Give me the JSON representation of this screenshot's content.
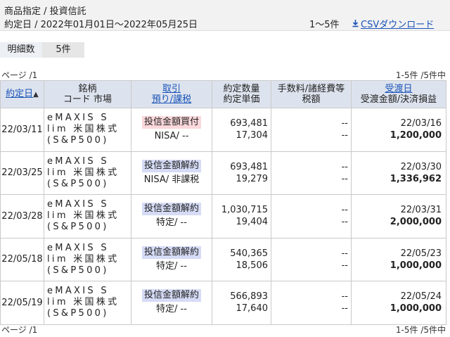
{
  "header": {
    "title": "商品指定 / 投資信託",
    "date_range": "約定日 / 2022年01月01日〜2022年05月25日",
    "count": "1〜5件",
    "csv_label": "CSVダウンロード"
  },
  "tabs": [
    {
      "label": "明細数"
    },
    {
      "label": "5件"
    }
  ],
  "pagination": {
    "page_label": "ページ /1",
    "range_label": "1-5件 /5件中"
  },
  "columns": {
    "date": "約定日",
    "sort_arrow": "▲",
    "fund_line1": "銘柄",
    "fund_line2": "コード 市場",
    "trade_line1": "取引",
    "trade_line2": "預り/課税",
    "qty_line1": "約定数量",
    "qty_line2": "約定単価",
    "fee_line1": "手数料/諸経費等",
    "fee_line2": "税額",
    "settle_line1": "受渡日",
    "settle_line2": "受渡金額/決済損益"
  },
  "rows": [
    {
      "date": "22/03/11",
      "name1": "eMAXIS S",
      "name2": "lim 米国株式",
      "name3": "(S&P500)",
      "trade": "投信金額買付",
      "trade_kind": "buy",
      "account": "NISA/ --",
      "qty": "693,481",
      "price": "17,304",
      "fee": "--",
      "tax": "--",
      "settle_date": "22/03/16",
      "amount": "1,200,000"
    },
    {
      "date": "22/03/25",
      "name1": "eMAXIS S",
      "name2": "lim 米国株式",
      "name3": "(S&P500)",
      "trade": "投信金額解約",
      "trade_kind": "sell",
      "account": "NISA/ 非課税",
      "qty": "693,481",
      "price": "19,279",
      "fee": "--",
      "tax": "--",
      "settle_date": "22/03/30",
      "amount": "1,336,962"
    },
    {
      "date": "22/03/28",
      "name1": "eMAXIS S",
      "name2": "lim 米国株式",
      "name3": "(S&P500)",
      "trade": "投信金額解約",
      "trade_kind": "sell",
      "account": "特定/ --",
      "qty": "1,030,715",
      "price": "19,404",
      "fee": "--",
      "tax": "--",
      "settle_date": "22/03/31",
      "amount": "2,000,000"
    },
    {
      "date": "22/05/18",
      "name1": "eMAXIS S",
      "name2": "lim 米国株式",
      "name3": "(S&P500)",
      "trade": "投信金額解約",
      "trade_kind": "sell",
      "account": "特定/ --",
      "qty": "540,365",
      "price": "18,506",
      "fee": "--",
      "tax": "--",
      "settle_date": "22/05/23",
      "amount": "1,000,000"
    },
    {
      "date": "22/05/19",
      "name1": "eMAXIS S",
      "name2": "lim 米国株式",
      "name3": "(S&P500)",
      "trade": "投信金額解約",
      "trade_kind": "sell",
      "account": "特定/ --",
      "qty": "566,893",
      "price": "17,640",
      "fee": "--",
      "tax": "--",
      "settle_date": "22/05/24",
      "amount": "1,000,000"
    }
  ]
}
